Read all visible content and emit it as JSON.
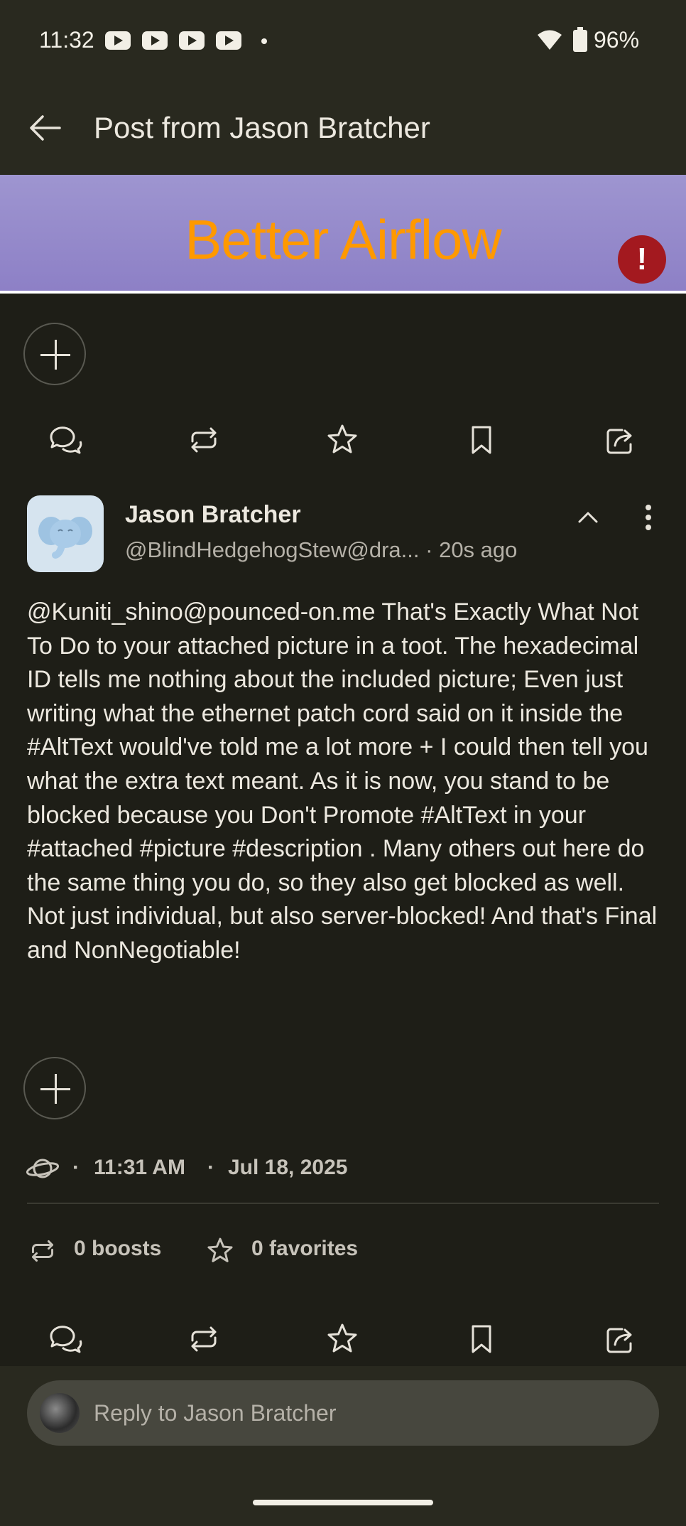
{
  "status_bar": {
    "time": "11:32",
    "battery": "96%",
    "notification_icons": [
      "youtube-icon",
      "youtube-icon",
      "youtube-icon",
      "youtube-icon"
    ]
  },
  "app_bar": {
    "title": "Post from Jason Bratcher"
  },
  "banner": {
    "text": "Better Airflow",
    "warning_glyph": "!"
  },
  "post": {
    "author_name": "Jason Bratcher",
    "author_handle": "@BlindHedgehogStew@dra...",
    "relative_time": "· 20s ago",
    "body": "@Kuniti_shino@pounced-on.me That's Exactly What Not To Do to your attached picture in a toot. The hexadecimal ID tells me nothing about the included picture; Even just writing what the ethernet patch cord said on it inside the #AltText would've told me a lot more + I could then tell you what the extra text meant. As it is now, you stand to be blocked because you Don't Promote #AltText in your #attached #picture #description . Many others out here do the same thing you do, so they also get blocked as well. Not just individual, but also server-blocked! And that's Final and NonNegotiable!",
    "meta_sep1": "·",
    "time": "11:31 AM",
    "meta_sep2": "·",
    "date": "Jul 18, 2025",
    "boosts": "0 boosts",
    "favorites": "0 favorites"
  },
  "reply": {
    "placeholder": "Reply to Jason Bratcher"
  },
  "colors": {
    "background": "#1e1e17",
    "bar": "#29291f",
    "banner_text": "#ff9900",
    "banner_bg": "#9188c8",
    "warning": "#a3191f"
  }
}
